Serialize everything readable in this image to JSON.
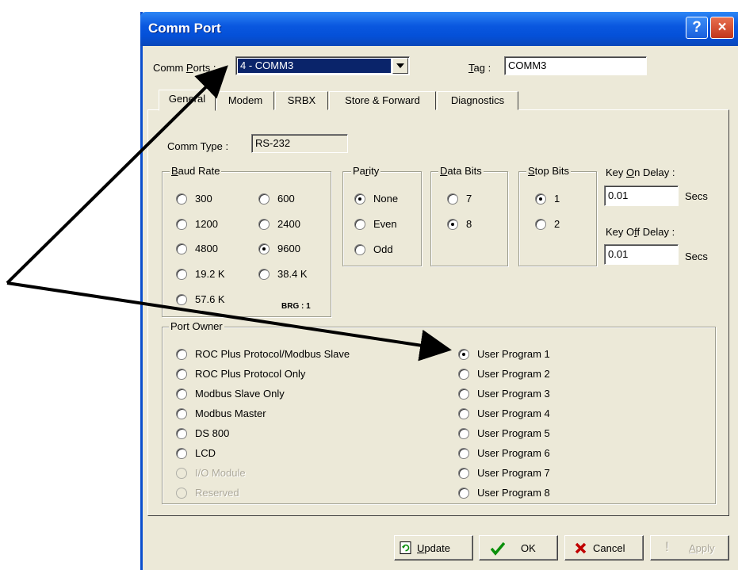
{
  "window": {
    "title": "Comm Port",
    "help_glyph": "?",
    "close_glyph": "×"
  },
  "header": {
    "comm_ports_label": "Comm Ports :",
    "comm_ports_value": "4 - COMM3",
    "tag_label": "Tag :",
    "tag_value": "COMM3"
  },
  "tabs": [
    "General",
    "Modem",
    "SRBX",
    "Store & Forward",
    "Diagnostics"
  ],
  "general": {
    "comm_type_label": "Comm Type :",
    "comm_type_value": "RS-232",
    "baud_rate": {
      "legend": "Baud Rate",
      "options": [
        "300",
        "600",
        "1200",
        "2400",
        "4800",
        "9600",
        "19.2 K",
        "38.4 K",
        "57.6 K"
      ],
      "selected": "9600",
      "brg": "BRG : 1"
    },
    "parity": {
      "legend": "Parity",
      "options": [
        "None",
        "Even",
        "Odd"
      ],
      "selected": "None"
    },
    "data_bits": {
      "legend": "Data Bits",
      "options": [
        "7",
        "8"
      ],
      "selected": "8"
    },
    "stop_bits": {
      "legend": "Stop Bits",
      "options": [
        "1",
        "2"
      ],
      "selected": "1"
    },
    "key_on_delay": {
      "label": "Key On Delay :",
      "value": "0.01",
      "unit": "Secs"
    },
    "key_off_delay": {
      "label": "Key Off Delay :",
      "value": "0.01",
      "unit": "Secs"
    },
    "port_owner": {
      "legend": "Port Owner",
      "left_options": [
        "ROC Plus Protocol/Modbus Slave",
        "ROC Plus Protocol Only",
        "Modbus Slave Only",
        "Modbus Master",
        "DS 800",
        "LCD",
        "I/O Module",
        "Reserved"
      ],
      "disabled": [
        "I/O Module",
        "Reserved"
      ],
      "right_options": [
        "User Program 1",
        "User Program 2",
        "User Program 3",
        "User Program 4",
        "User Program 5",
        "User Program 6",
        "User Program 7",
        "User Program 8"
      ],
      "selected": "User Program 1"
    }
  },
  "buttons": {
    "update": "Update",
    "ok": "OK",
    "cancel": "Cancel",
    "apply": "Apply"
  },
  "colors": {
    "title_bar": "#0A58E0",
    "face": "#ECE9D8",
    "ok_check": "#0A8F0A",
    "cancel_x": "#C00000"
  }
}
